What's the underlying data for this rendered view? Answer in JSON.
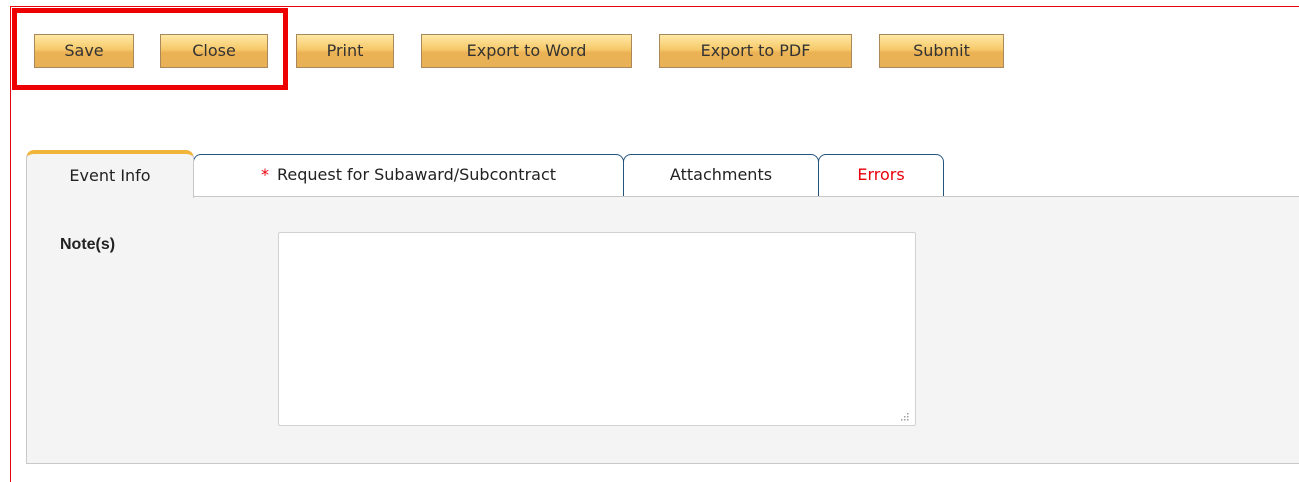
{
  "toolbar": {
    "buttons": [
      {
        "label": "Save"
      },
      {
        "label": "Close"
      },
      {
        "label": "Print"
      },
      {
        "label": "Export to Word"
      },
      {
        "label": "Export to PDF"
      },
      {
        "label": "Submit"
      }
    ]
  },
  "tabs": [
    {
      "label": "Event Info",
      "active": true
    },
    {
      "label": "Request for Subaward/Subcontract",
      "required_marker": "*"
    },
    {
      "label": "Attachments"
    },
    {
      "label": "Errors"
    }
  ],
  "form": {
    "notes_label": "Note(s)",
    "notes_value": ""
  },
  "colors": {
    "accent_red": "#e8000b",
    "button_gold": "#f6c96a",
    "tab_border": "#24537e",
    "active_tab_top": "#f2b53b"
  },
  "icons": {
    "resize_grip": "resize-grip-icon"
  }
}
